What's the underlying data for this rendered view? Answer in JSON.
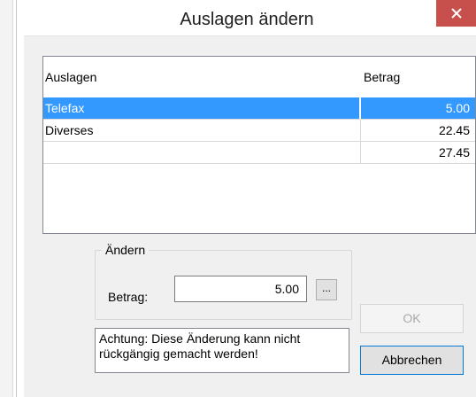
{
  "window": {
    "title": "Auslagen ändern"
  },
  "list": {
    "headers": {
      "auslagen": "Auslagen",
      "betrag": "Betrag"
    },
    "rows": [
      {
        "auslagen": "Telefax",
        "betrag": "5.00",
        "selected": true
      },
      {
        "auslagen": "Diverses",
        "betrag": "22.45",
        "selected": false
      },
      {
        "auslagen": "",
        "betrag": "27.45",
        "selected": false
      }
    ]
  },
  "edit_group": {
    "label": "Ändern",
    "betrag_label": "Betrag:",
    "betrag_value": "5.00",
    "browse_label": "..."
  },
  "warning": "Achtung: Diese Änderung kann nicht rückgängig gemacht werden!",
  "buttons": {
    "ok": "OK",
    "cancel": "Abbrechen"
  },
  "colors": {
    "selection": "#3399ff",
    "close_button": "#c7504d",
    "dialog_bg": "#f0f0f0"
  }
}
